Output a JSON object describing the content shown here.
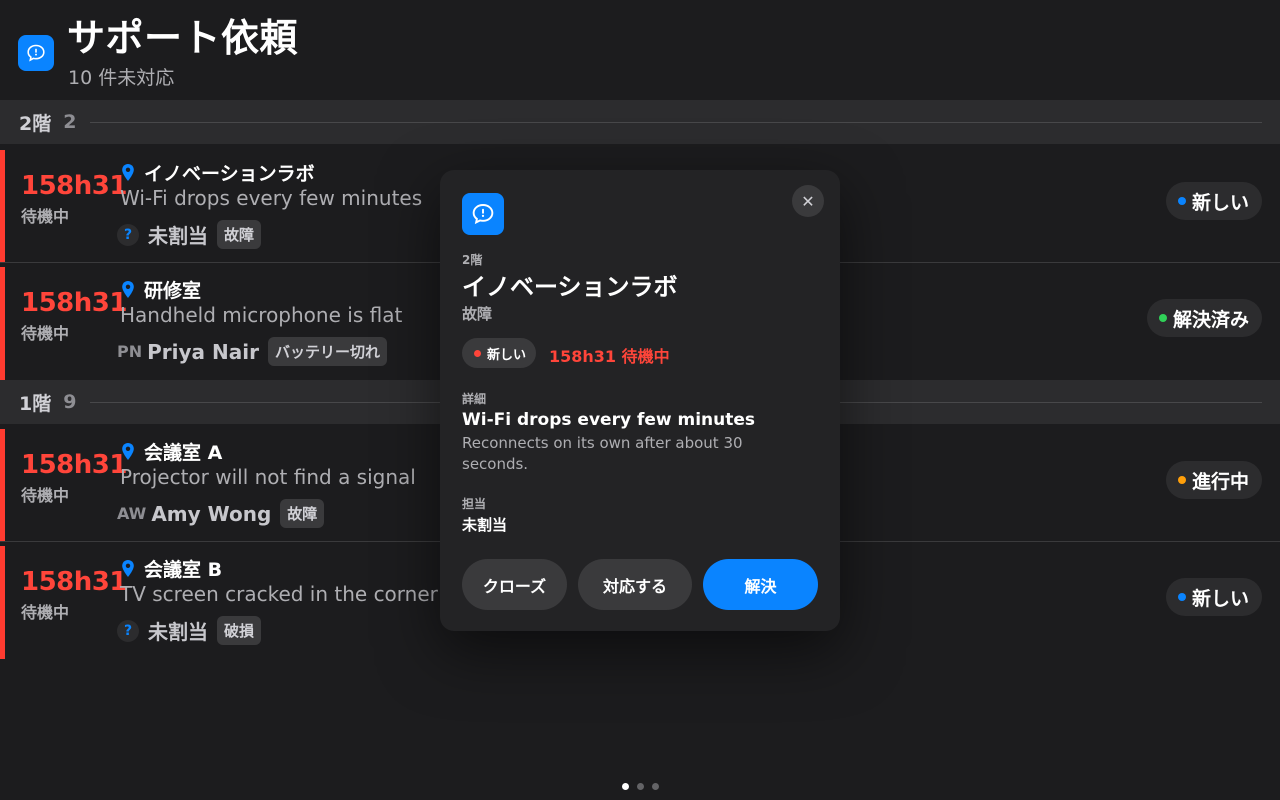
{
  "header": {
    "title": "サポート依頼",
    "subtitle": "10 件未対応",
    "icon": "chat-bubble-icon"
  },
  "colors": {
    "accent_blue": "#0a84ff",
    "urgent_red": "#ff453a",
    "dot_new": "#0a84ff",
    "dot_resolved": "#30d158",
    "dot_in_progress": "#ff9f0a",
    "dot_modal_new": "#ff453a"
  },
  "sections": [
    {
      "title": "2階",
      "count": "2"
    },
    {
      "title": "1階",
      "count": "9"
    }
  ],
  "rows": [
    {
      "time": "158h31",
      "wait": "待機中",
      "location": "イノベーションラボ",
      "issue": "Wi-Fi drops every few minutes",
      "assignee_icon": "question-icon",
      "assignee_badge": "?",
      "assignee": "未割当",
      "tag": "故障",
      "status": "新しい",
      "status_color": "#0a84ff"
    },
    {
      "time": "158h31",
      "wait": "待機中",
      "location": "研修室",
      "issue": "Handheld microphone is flat",
      "assignee_initials": "PN",
      "assignee": "Priya Nair",
      "tag": "バッテリー切れ",
      "status": "解決済み",
      "status_color": "#30d158"
    },
    {
      "time": "158h31",
      "wait": "待機中",
      "location": "会議室 A",
      "issue": "Projector will not find a signal",
      "assignee_initials": "AW",
      "assignee": "Amy Wong",
      "tag": "故障",
      "status": "進行中",
      "status_color": "#ff9f0a"
    },
    {
      "time": "158h31",
      "wait": "待機中",
      "location": "会議室 B",
      "issue": "TV screen cracked in the corner",
      "assignee_icon": "question-icon",
      "assignee_badge": "?",
      "assignee": "未割当",
      "tag": "破損",
      "status": "新しい",
      "status_color": "#0a84ff"
    }
  ],
  "modal": {
    "icon": "chat-bubble-icon",
    "close_icon": "close-icon",
    "close_glyph": "✕",
    "floor": "2階",
    "title": "イノベーションラボ",
    "category": "故障",
    "status": "新しい",
    "wait": "158h31 待機中",
    "detail_label": "詳細",
    "detail_title": "Wi-Fi drops every few minutes",
    "detail_body": "Reconnects on its own after about 30 seconds.",
    "assignee_label": "担当",
    "assignee": "未割当",
    "buttons": {
      "close": "クローズ",
      "respond": "対応する",
      "resolve": "解決"
    }
  },
  "pagination": {
    "pages": 3,
    "current": 1
  }
}
